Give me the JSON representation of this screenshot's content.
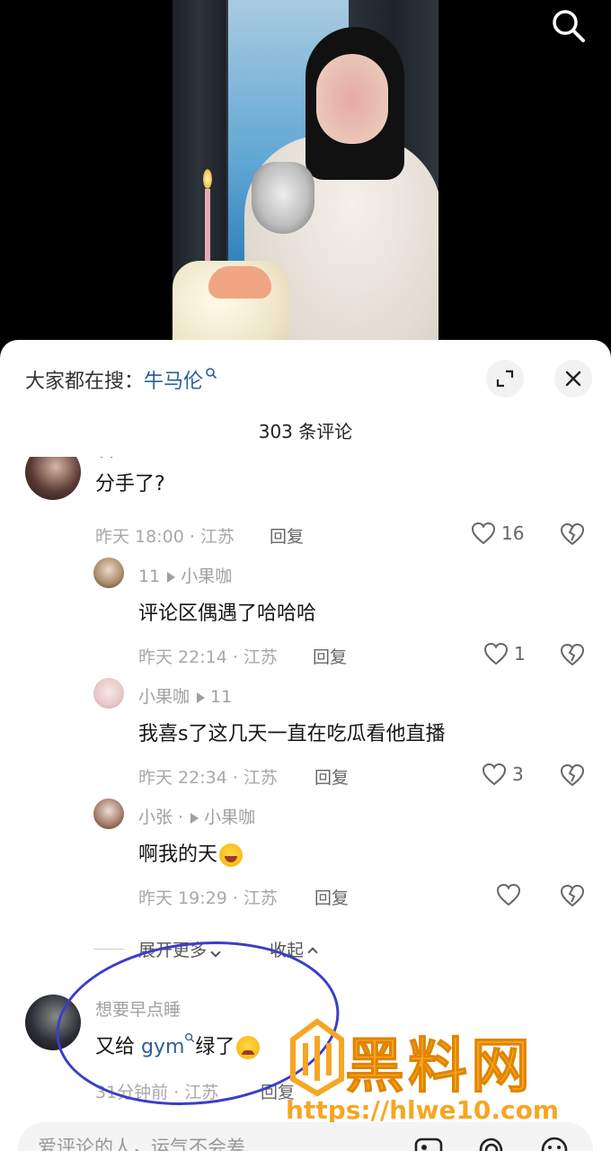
{
  "header": {
    "hot_search_prefix": "大家都在搜：",
    "hot_search_term": "牛马伦",
    "comment_count": "303 条评论"
  },
  "comments": [
    {
      "text": "分手了?",
      "meta": "昨天 18:00 · 江苏",
      "reply_label": "回复",
      "likes": "16"
    },
    {
      "author": "11",
      "reply_to": "小果咖",
      "text": "评论区偶遇了哈哈哈",
      "meta": "昨天 22:14 · 江苏",
      "reply_label": "回复",
      "likes": "1"
    },
    {
      "author": "小果咖",
      "reply_to": "11",
      "text": "我喜s了这几天一直在吃瓜看他直播",
      "meta": "昨天 22:34 · 江苏",
      "reply_label": "回复",
      "likes": "3"
    },
    {
      "author": "小张 ·",
      "reply_to": "小果咖",
      "text": "啊我的天",
      "meta": "昨天 19:29 · 江苏",
      "reply_label": "回复",
      "likes": ""
    },
    {
      "author": "想要早点睡",
      "text_before": "又给 ",
      "highlight": "gym",
      "text_after": "绿了",
      "meta": "31分钟前 · 江苏",
      "reply_label": "回复"
    }
  ],
  "thread_controls": {
    "expand_more": "展开更多",
    "collapse": "收起"
  },
  "input": {
    "placeholder": "爱评论的人，运气不会差"
  },
  "watermark": {
    "title": "黑料网",
    "url": "https://hlwe10.com"
  },
  "colors": {
    "accent_link": "#2c5d9b",
    "watermark": "#f7a623",
    "annotation": "#3b3ec8"
  },
  "icons": [
    "search-icon",
    "expand-icon",
    "close-icon",
    "heart-icon",
    "broken-heart-icon",
    "image-icon",
    "at-icon",
    "emoji-icon"
  ]
}
